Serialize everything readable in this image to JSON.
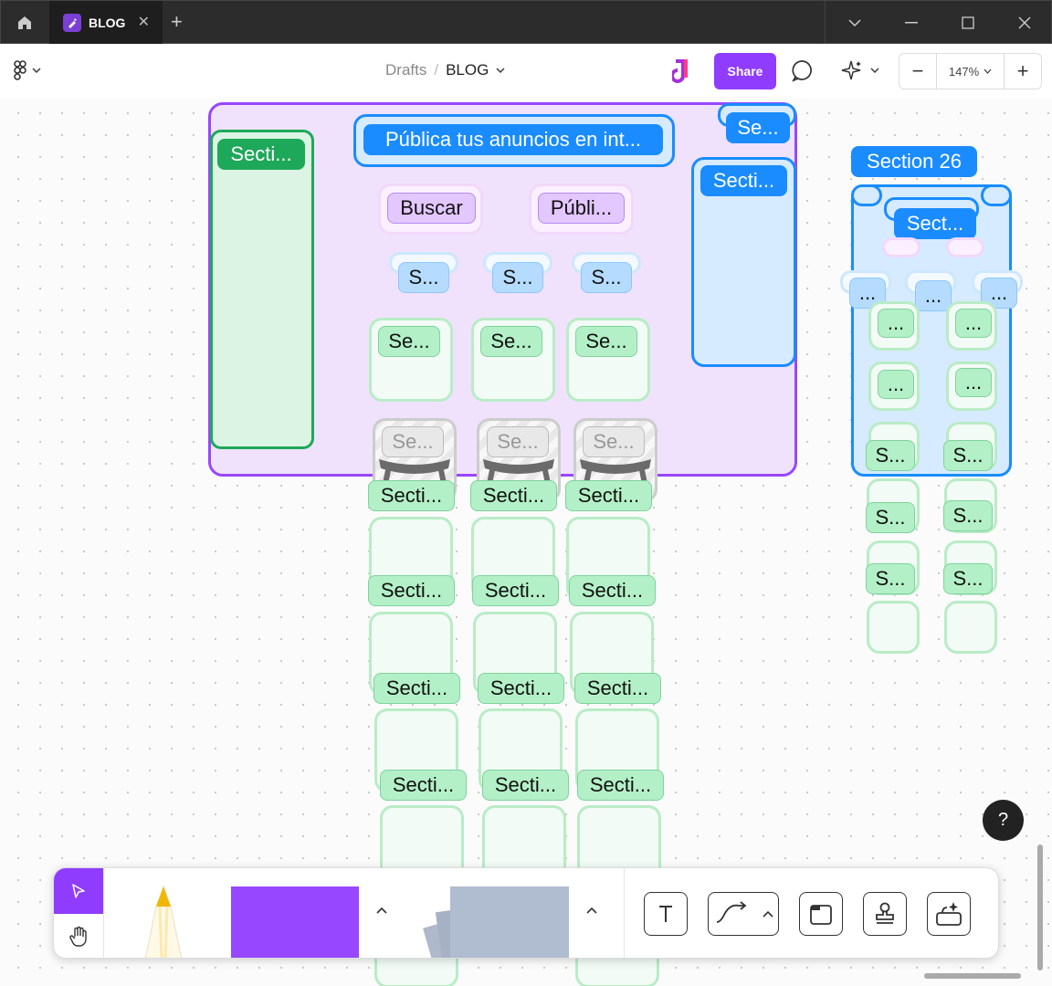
{
  "titlebar": {
    "tab_title": "BLOG",
    "tab_close": "✕",
    "new_tab": "+"
  },
  "toolbar": {
    "breadcrumb_root": "Drafts",
    "breadcrumb_sep": "/",
    "file_name": "BLOG",
    "share_label": "Share",
    "zoom_value": "147%",
    "zoom_minus": "−",
    "zoom_plus": "+"
  },
  "canvas": {
    "main_title": "Pública tus anuncios en int...",
    "left_section": "Secti...",
    "top_right_se": "Se...",
    "right_section": "Secti...",
    "buscar": "Buscar",
    "publi": "Públi...",
    "s_labels": [
      "S...",
      "S...",
      "S..."
    ],
    "se_labels": [
      "Se...",
      "Se...",
      "Se..."
    ],
    "gray_labels": [
      "Se...",
      "Se...",
      "Se..."
    ],
    "secti_row1": [
      "Secti...",
      "Secti...",
      "Secti..."
    ],
    "secti_row2": [
      "Secti...",
      "Secti...",
      "Secti..."
    ],
    "secti_row3": [
      "Secti...",
      "Secti...",
      "Secti..."
    ],
    "secti_row4": [
      "Secti...",
      "Secti...",
      "Secti..."
    ],
    "section26": {
      "title": "Section 26",
      "sect": "Sect...",
      "dots": [
        "...",
        "...",
        "..."
      ],
      "green_dots": [
        "...",
        "...",
        "...",
        "..."
      ],
      "s_labels": [
        "S...",
        "S...",
        "S...",
        "S...",
        "S...",
        "S..."
      ]
    }
  },
  "help_label": "?",
  "colors": {
    "accent": "#8f3cff",
    "blue": "#1a8cff",
    "green": "#1ea85a"
  }
}
